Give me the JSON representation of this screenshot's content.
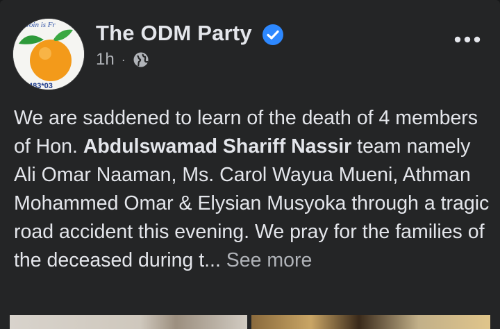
{
  "post": {
    "page_name": "The ODM Party",
    "timestamp": "1h",
    "separator": "·",
    "audience_icon": "globe-icon",
    "verified_icon": "verified-badge-icon",
    "more_icon": "more-options-icon",
    "avatar": {
      "text_top": "Join is Fr",
      "text_bottom": "483*03"
    },
    "body": {
      "part1": "We are saddened to learn of the death of 4 members of Hon. ",
      "bold_name": "Abdulswamad Shariff Nassir",
      "part2": "  team namely Ali Omar Naaman, Ms. Carol Wayua Mueni, Athman Mohammed Omar & Elysian Musyoka through a tragic road accident this evening. We pray for the families of the deceased during t... ",
      "see_more": "See more"
    }
  },
  "colors": {
    "background": "#242526",
    "text_primary": "#e4e6eb",
    "text_secondary": "#b0b3b8",
    "verified_blue": "#2d88ff"
  }
}
